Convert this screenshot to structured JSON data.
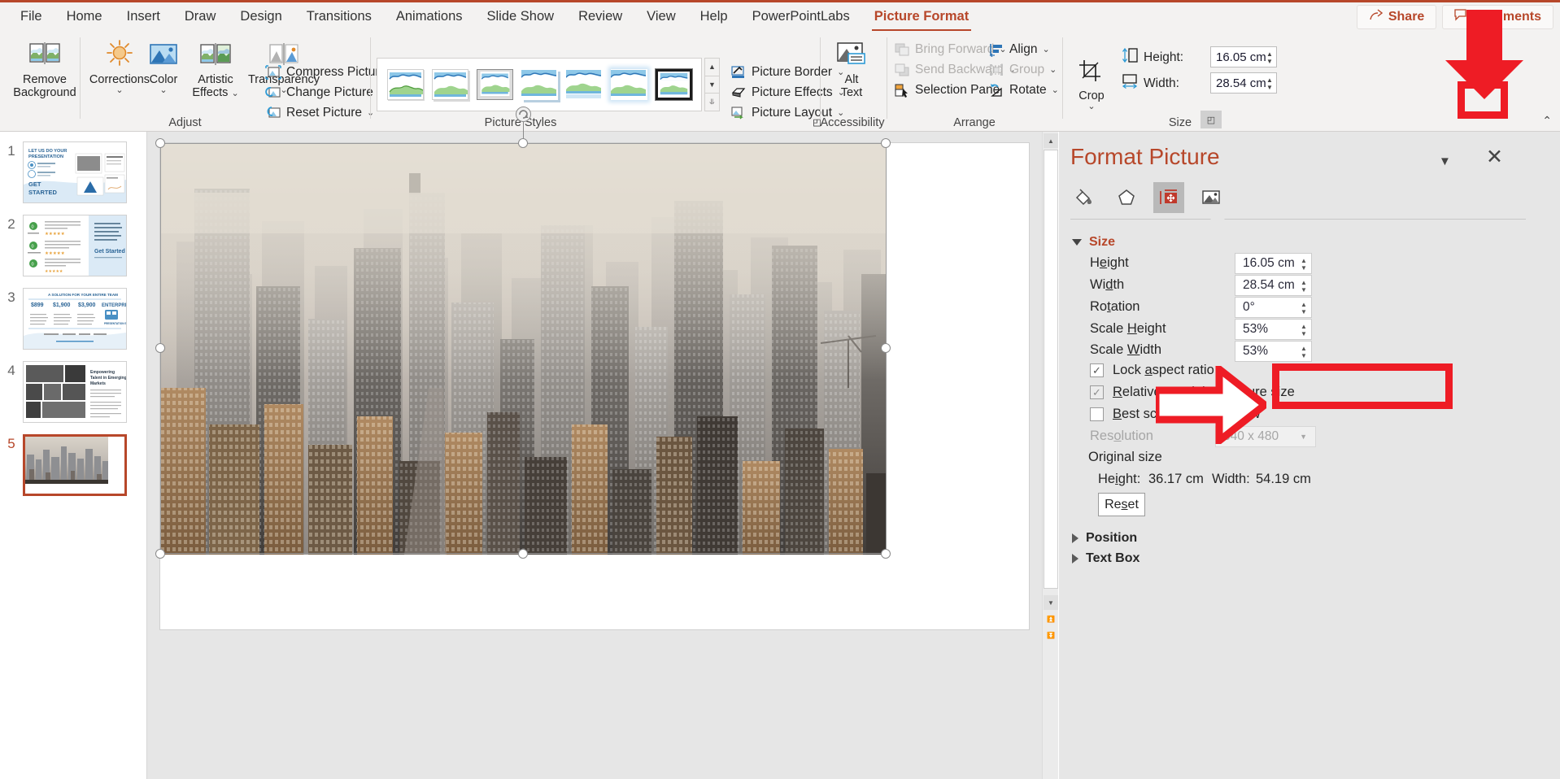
{
  "window": {
    "app": "PowerPoint",
    "tabs": [
      {
        "label": "File"
      },
      {
        "label": "Home"
      },
      {
        "label": "Insert"
      },
      {
        "label": "Draw"
      },
      {
        "label": "Design"
      },
      {
        "label": "Transitions"
      },
      {
        "label": "Animations"
      },
      {
        "label": "Slide Show"
      },
      {
        "label": "Review"
      },
      {
        "label": "View"
      },
      {
        "label": "Help"
      },
      {
        "label": "PowerPointLabs"
      },
      {
        "label": "Picture Format"
      }
    ],
    "active_tab": "Picture Format",
    "share_label": "Share",
    "comments_label": "Comments",
    "accent_color": "#b7472a",
    "annotation_color": "#ee1c25"
  },
  "ribbon": {
    "groups": [
      {
        "name": "Adjust",
        "label": "Adjust"
      },
      {
        "name": "Picture Styles",
        "label": "Picture Styles"
      },
      {
        "name": "Accessibility",
        "label": "Accessibility"
      },
      {
        "name": "Arrange",
        "label": "Arrange"
      },
      {
        "name": "Size",
        "label": "Size"
      }
    ],
    "adjust": {
      "remove_background": "Remove\nBackground",
      "remove_background_l1": "Remove",
      "remove_background_l2": "Background",
      "corrections": "Corrections",
      "color": "Color",
      "artistic_effects_l1": "Artistic",
      "artistic_effects_l2": "Effects",
      "transparency": "Transparency",
      "compress_pictures": "Compress Pictures",
      "change_picture": "Change Picture",
      "reset_picture": "Reset Picture"
    },
    "picture_styles": {
      "border": "Picture Border",
      "effects": "Picture Effects",
      "layout": "Picture Layout",
      "selected_style_index": 6,
      "style_count": 7
    },
    "accessibility": {
      "alt_text_l1": "Alt",
      "alt_text_l2": "Text"
    },
    "arrange": {
      "bring_forward": "Bring Forward",
      "send_backward": "Send Backward",
      "selection_pane": "Selection Pane",
      "align": "Align",
      "group": "Group",
      "rotate": "Rotate"
    },
    "size": {
      "crop": "Crop",
      "height_label": "Height:",
      "height_value": "16.05 cm",
      "width_label": "Width:",
      "width_value": "28.54 cm"
    }
  },
  "slides": [
    {
      "number": "1",
      "selected": false
    },
    {
      "number": "2",
      "selected": false
    },
    {
      "number": "3",
      "selected": false
    },
    {
      "number": "4",
      "selected": false
    },
    {
      "number": "5",
      "selected": true
    }
  ],
  "format_picture": {
    "title": "Format Picture",
    "tabs": [
      "fill-icon",
      "effects-icon",
      "size-properties-icon",
      "picture-icon"
    ],
    "selected_tab": "size-properties-icon",
    "size_section": {
      "heading": "Size",
      "rows": [
        {
          "label": "Height",
          "label_pre": "H",
          "label_acc": "e",
          "label_post": "ight",
          "value": "16.05 cm"
        },
        {
          "label": "Width",
          "label_pre": "Wi",
          "label_acc": "d",
          "label_post": "th",
          "value": "28.54 cm"
        },
        {
          "label": "Rotation",
          "label_pre": "Ro",
          "label_acc": "t",
          "label_post": "ation",
          "value": "0°"
        },
        {
          "label": "Scale Height",
          "label_pre": "Scale ",
          "label_acc": "H",
          "label_post": "eight",
          "value": "53%"
        },
        {
          "label": "Scale Width",
          "label_pre": "Scale ",
          "label_acc": "W",
          "label_post": "idth",
          "value": "53%"
        }
      ],
      "checkboxes": [
        {
          "label": "Lock aspect ratio",
          "pre": "Lock ",
          "acc": "a",
          "post": "spect ratio",
          "checked": true,
          "enabled": true
        },
        {
          "label": "Relative to original picture size",
          "pre": "",
          "acc": "R",
          "post": "elative to original picture size",
          "checked": true,
          "enabled": true
        },
        {
          "label": "Best scale for slide show",
          "pre": "",
          "acc": "B",
          "post": "est scale for slide show",
          "checked": false,
          "enabled": true
        }
      ],
      "resolution_label": "Resolution",
      "resolution_value": "640 x 480",
      "original_size_label": "Original size",
      "original_height_label": "Height:",
      "original_height_value": "36.17 cm",
      "original_width_label": "Width:",
      "original_width_value": "54.19 cm",
      "reset_label": "Reset",
      "reset_pre": "Re",
      "reset_acc": "s",
      "reset_post": "et"
    },
    "collapsed_sections": [
      {
        "label": "Position"
      },
      {
        "label": "Text Box"
      }
    ]
  },
  "annotations": [
    {
      "name": "arrow-down-to-size-dialog-launcher",
      "type": "arrow-down"
    },
    {
      "name": "highlight-size-dialog-launcher",
      "type": "box"
    },
    {
      "name": "arrow-right-to-lock-aspect-ratio",
      "type": "arrow-right"
    },
    {
      "name": "highlight-lock-aspect-ratio",
      "type": "box"
    }
  ]
}
